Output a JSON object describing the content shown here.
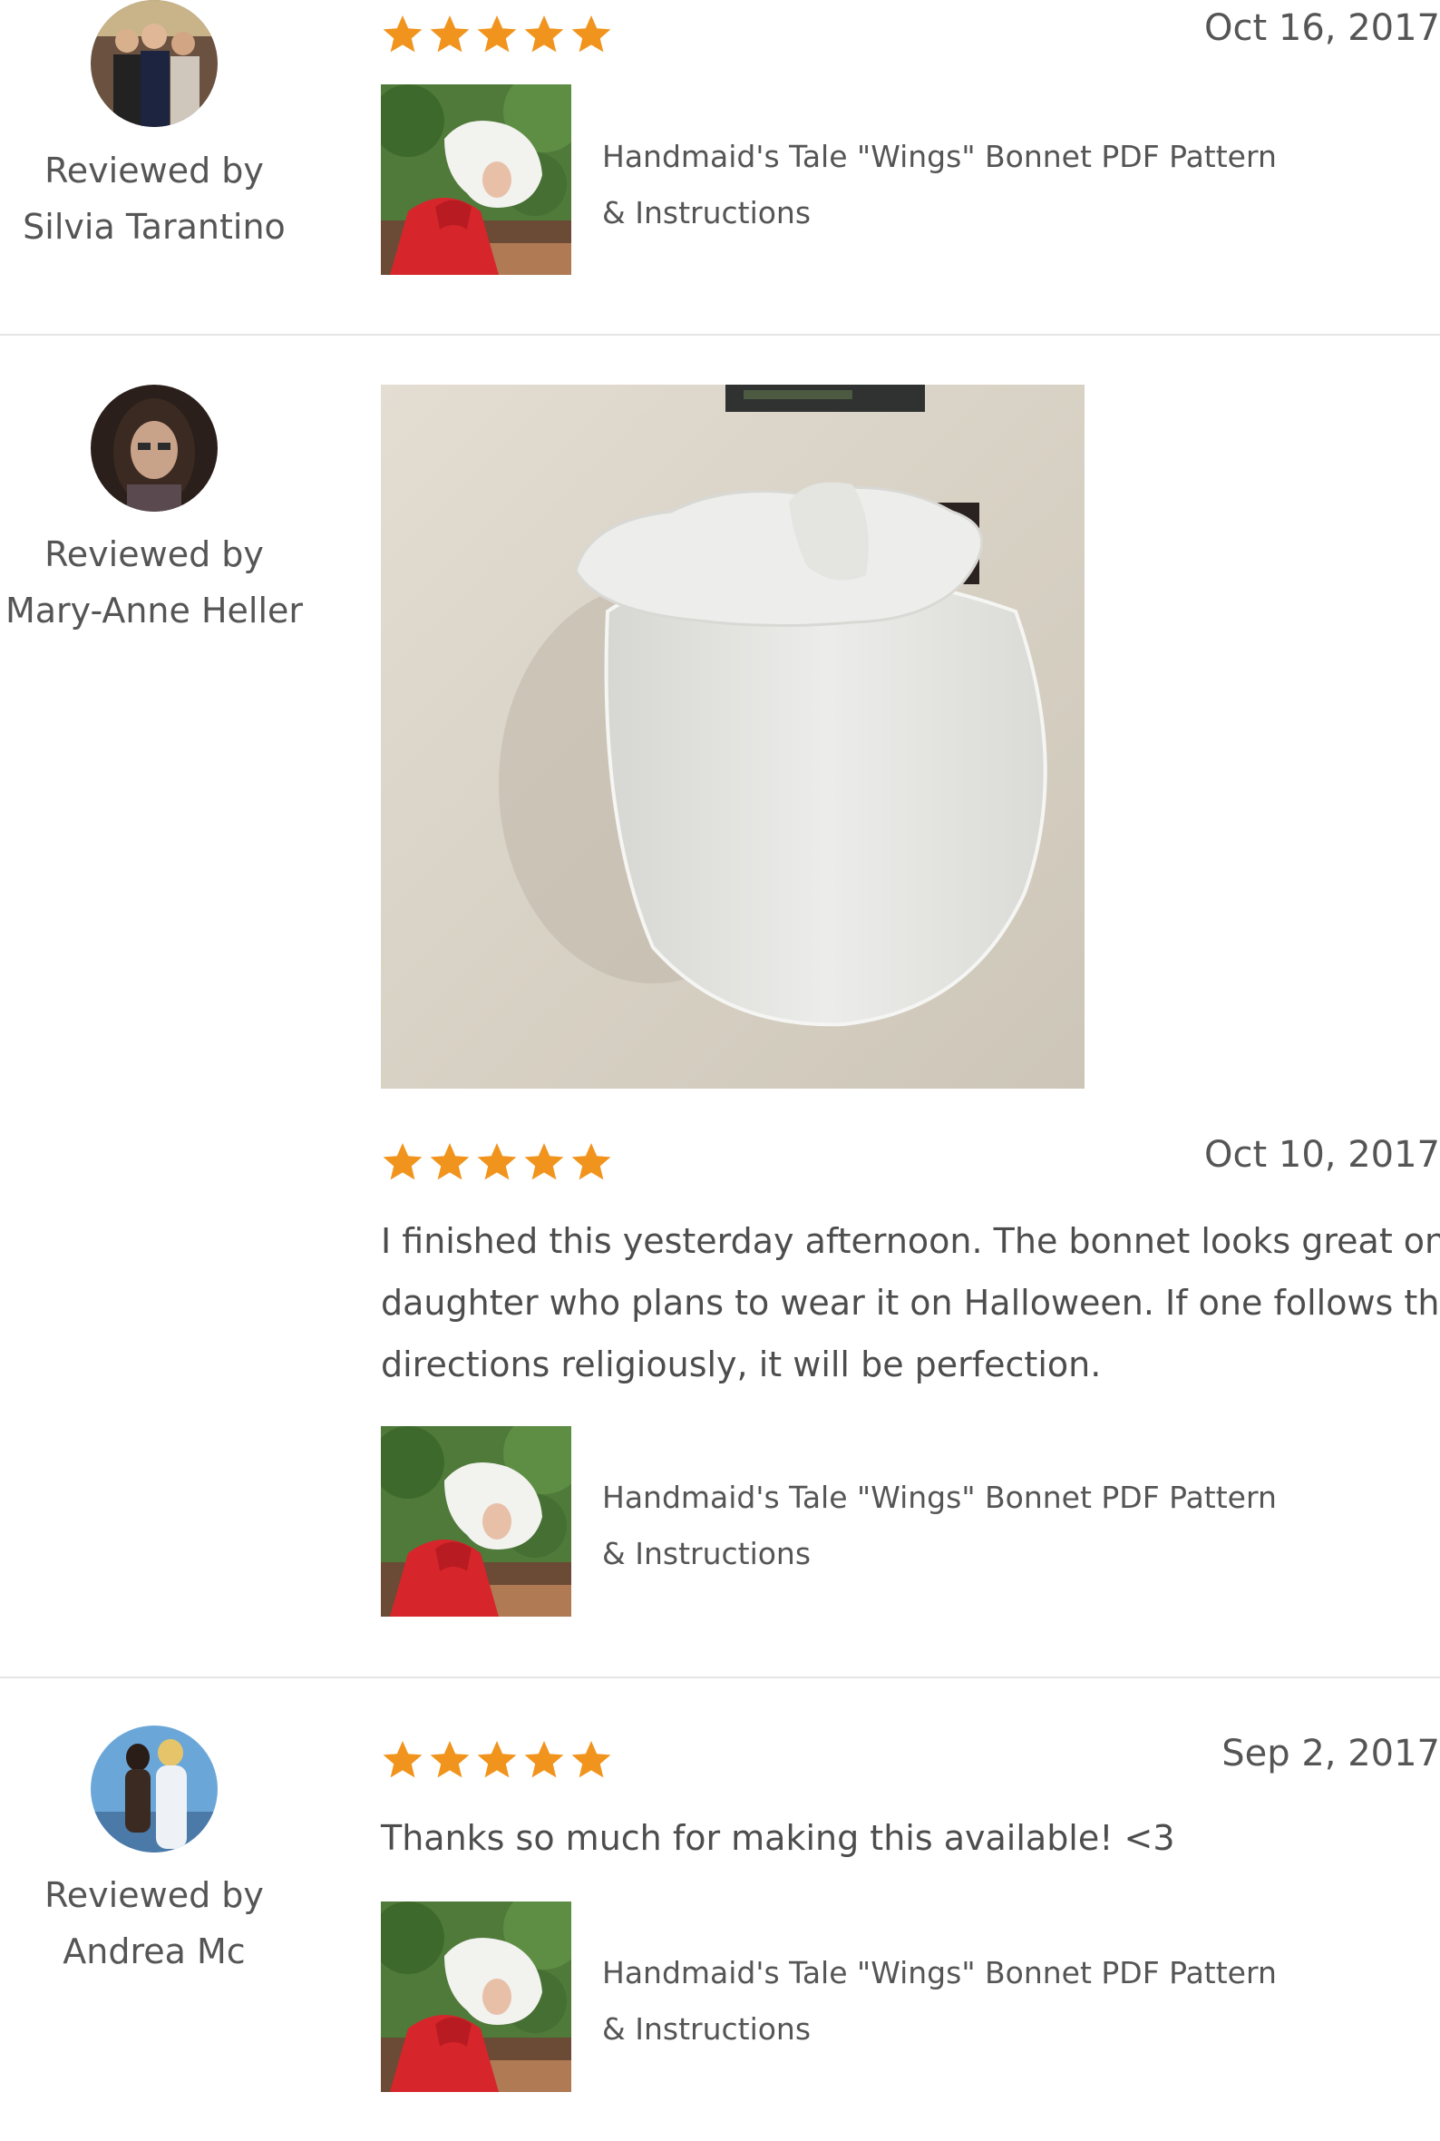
{
  "reviews": [
    {
      "reviewer_prefix": "Reviewed by",
      "reviewer_name": "Silvia Tarantino",
      "rating": 5,
      "date": "Oct 16, 2017",
      "text": "",
      "product": {
        "title": "Handmaid's Tale \"Wings\" Bonnet PDF Pattern & Instructions"
      }
    },
    {
      "reviewer_prefix": "Reviewed by",
      "reviewer_name": "Mary-Anne Heller",
      "rating": 5,
      "date": "Oct 10, 2017",
      "text": "I finished this yesterday afternoon. The bonnet looks great on my daughter who plans to wear it on Halloween. If one follows the directions religiously, it will be perfection.",
      "product": {
        "title": "Handmaid's Tale \"Wings\" Bonnet PDF Pattern & Instructions"
      }
    },
    {
      "reviewer_prefix": "Reviewed by",
      "reviewer_name": "Andrea Mc",
      "rating": 5,
      "date": "Sep 2, 2017",
      "text": "Thanks so much for making this available! <3",
      "product": {
        "title": "Handmaid's Tale \"Wings\" Bonnet PDF Pattern & Instructions"
      }
    }
  ],
  "colors": {
    "star": "#F1941D",
    "divider": "#E5E5E5",
    "text": "#595959"
  },
  "icons": {
    "star": "star-icon"
  }
}
